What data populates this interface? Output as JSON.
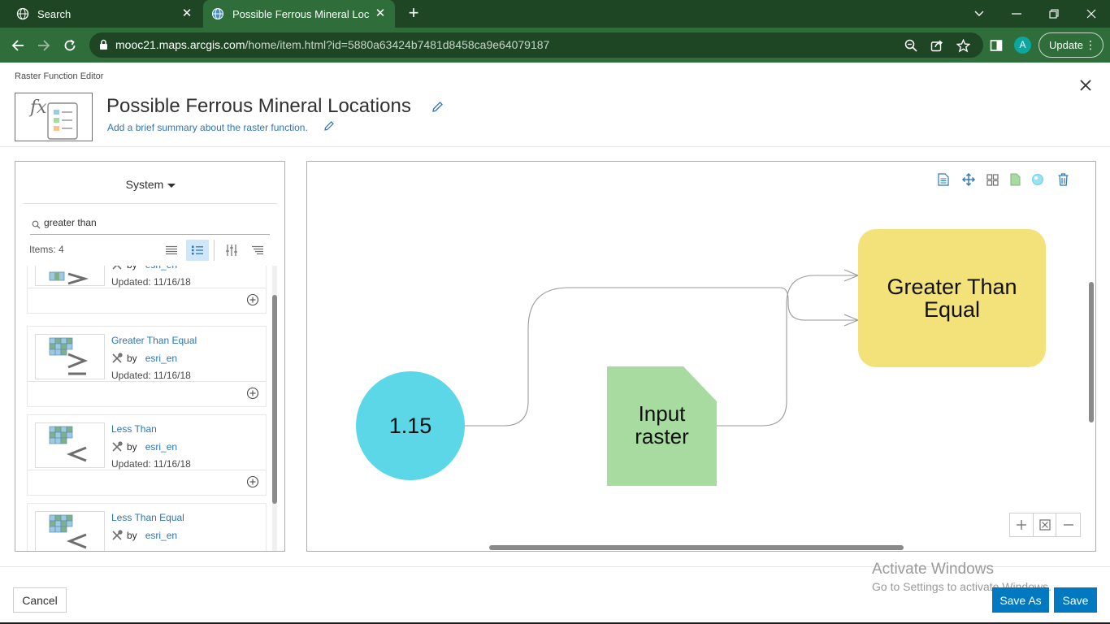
{
  "browser": {
    "tabs": [
      {
        "title": "Search",
        "active": false
      },
      {
        "title": "Possible Ferrous Mineral Locatio",
        "active": true
      }
    ],
    "url_host": "mooc21.maps.arcgis.com",
    "url_path": "/home/item.html?id=5880a63424b7481d8458ca9e64079187",
    "profile_initial": "A",
    "update_label": "Update"
  },
  "editor": {
    "label": "Raster Function Editor",
    "title": "Possible Ferrous Mineral Locations",
    "summary_placeholder": "Add a brief summary about the raster function."
  },
  "left_panel": {
    "source_dropdown": "System",
    "search_value": "greater than",
    "items_count": "Items: 4",
    "by_label": "by",
    "cards": [
      {
        "name": "",
        "author": "esri_en",
        "updated": "Updated: 11/16/18",
        "icon": "greater-than-icon"
      },
      {
        "name": "Greater Than Equal",
        "author": "esri_en",
        "updated": "Updated: 11/16/18",
        "icon": "greater-than-equal-icon"
      },
      {
        "name": "Less Than",
        "author": "esri_en",
        "updated": "Updated: 11/16/18",
        "icon": "less-than-icon"
      },
      {
        "name": "Less Than Equal",
        "author": "esri_en",
        "updated": "",
        "icon": "less-than-equal-icon"
      }
    ]
  },
  "canvas": {
    "constant_node": "1.15",
    "raster_node_line1": "Input",
    "raster_node_line2": "raster",
    "function_node_line1": "Greater Than",
    "function_node_line2": "Equal",
    "colors": {
      "constant": "#5bd7e8",
      "raster": "#a8dba0",
      "function": "#f3e17a"
    }
  },
  "footer": {
    "cancel": "Cancel",
    "save_as": "Save As",
    "save": "Save"
  },
  "watermark": {
    "title": "Activate Windows",
    "subtitle": "Go to Settings to activate Windows."
  }
}
